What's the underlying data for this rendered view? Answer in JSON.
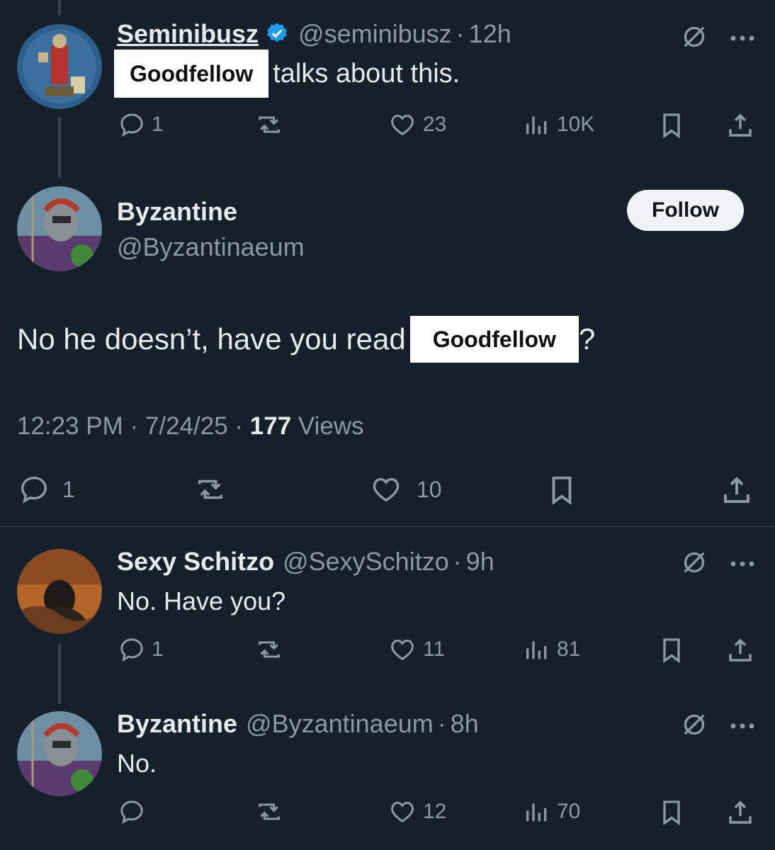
{
  "posts": [
    {
      "name": "Seminibusz",
      "verified": true,
      "handle": "@seminibusz",
      "time": "12h",
      "redacted": "Goodfellow",
      "text": "talks about this.",
      "replies": "1",
      "likes": "23",
      "views": "10K"
    },
    {
      "name": "Byzantine",
      "handle": "@Byzantinaeum",
      "follow_label": "Follow",
      "text_before": "No he doesn’t, have you read",
      "redacted": "Goodfellow",
      "text_after": "?",
      "timestamp": "12:23 PM · 7/24/25 · ",
      "views_count": "177",
      "views_label": " Views",
      "replies": "1",
      "likes": "10"
    },
    {
      "name": "Sexy Schitzo",
      "handle": "@SexySchitzo",
      "time": "9h",
      "text": "No. Have you?",
      "replies": "1",
      "likes": "11",
      "views": "81"
    },
    {
      "name": "Byzantine",
      "handle": "@Byzantinaeum",
      "time": "8h",
      "text": "No.",
      "likes": "12",
      "views": "70"
    }
  ],
  "separator": "·",
  "colors": {
    "background": "#15202b",
    "text": "#e7e9ea",
    "muted": "#8b98a5",
    "verified": "#1d9bf0"
  }
}
